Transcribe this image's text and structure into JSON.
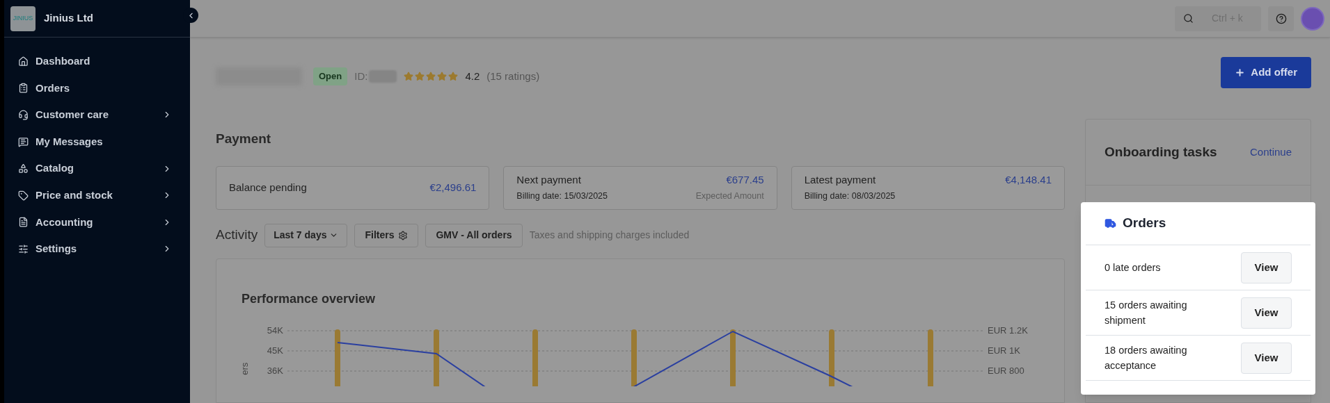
{
  "sidebar": {
    "company": "Jinius Ltd",
    "logo_text": "JINIUS",
    "items": [
      {
        "label": "Dashboard",
        "has_submenu": false
      },
      {
        "label": "Orders",
        "has_submenu": false
      },
      {
        "label": "Customer care",
        "has_submenu": true
      },
      {
        "label": "My Messages",
        "has_submenu": false
      },
      {
        "label": "Catalog",
        "has_submenu": true
      },
      {
        "label": "Price and stock",
        "has_submenu": true
      },
      {
        "label": "Accounting",
        "has_submenu": true
      },
      {
        "label": "Settings",
        "has_submenu": true
      }
    ]
  },
  "header": {
    "search_shortcut": "Ctrl + k"
  },
  "shop": {
    "status": "Open",
    "id_label": "ID:",
    "stars": 5,
    "rating": "4.2",
    "ratings_count": "(15 ratings)",
    "add_button": "Add offer"
  },
  "payment": {
    "title": "Payment",
    "cards": [
      {
        "title": "Balance pending",
        "amount": "€2,496.61"
      },
      {
        "title": "Next payment",
        "amount": "€677.45",
        "subtitle": "Billing date: 15/03/2025",
        "note": "Expected Amount"
      },
      {
        "title": "Latest payment",
        "amount": "€4,148.41",
        "subtitle": "Billing date: 08/03/2025"
      }
    ]
  },
  "activity": {
    "title": "Activity",
    "period": "Last 7 days",
    "filters": "Filters",
    "metric": "GMV - All orders",
    "note": "Taxes and shipping charges included"
  },
  "chart": {
    "title": "Performance overview",
    "left_ticks": [
      "54K",
      "45K",
      "36K"
    ],
    "right_ticks": [
      "EUR 1.2K",
      "EUR 1K",
      "EUR 800"
    ],
    "ylabel_visible": "ers"
  },
  "onboarding": {
    "title": "Onboarding tasks",
    "action": "Continue"
  },
  "orders": {
    "title": "Orders",
    "rows": [
      {
        "label": "0 late orders",
        "action": "View"
      },
      {
        "label": "15 orders awaiting shipment",
        "action": "View"
      },
      {
        "label": "18 orders awaiting acceptance",
        "action": "View"
      }
    ]
  }
}
